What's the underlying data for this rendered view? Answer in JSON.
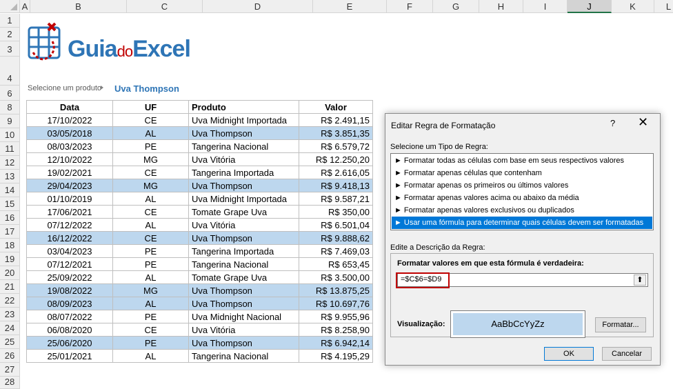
{
  "columns": [
    "A",
    "B",
    "C",
    "D",
    "E",
    "F",
    "G",
    "H",
    "I",
    "J",
    "K",
    "L"
  ],
  "selected_column": "J",
  "rows": [
    "1",
    "2",
    "3",
    "4",
    "6",
    "8",
    "9",
    "10",
    "11",
    "12",
    "13",
    "14",
    "15",
    "16",
    "17",
    "18",
    "19",
    "20",
    "21",
    "22",
    "23",
    "24",
    "25",
    "26",
    "27",
    "28"
  ],
  "logo": {
    "guia": "Guia",
    "do": "do",
    "excel": "Excel"
  },
  "selector": {
    "label": "Selecione um produto",
    "value": "Uva Thompson"
  },
  "table": {
    "headers": [
      "Data",
      "UF",
      "Produto",
      "Valor"
    ],
    "rows": [
      {
        "data": "17/10/2022",
        "uf": "CE",
        "produto": "Uva Midnight Importada",
        "valor": "R$ 2.491,15",
        "hl": false
      },
      {
        "data": "03/05/2018",
        "uf": "AL",
        "produto": "Uva Thompson",
        "valor": "R$ 3.851,35",
        "hl": true
      },
      {
        "data": "08/03/2023",
        "uf": "PE",
        "produto": "Tangerina Nacional",
        "valor": "R$ 6.579,72",
        "hl": false
      },
      {
        "data": "12/10/2022",
        "uf": "MG",
        "produto": "Uva Vitória",
        "valor": "R$ 12.250,20",
        "hl": false
      },
      {
        "data": "19/02/2021",
        "uf": "CE",
        "produto": "Tangerina Importada",
        "valor": "R$ 2.616,05",
        "hl": false
      },
      {
        "data": "29/04/2023",
        "uf": "MG",
        "produto": "Uva Thompson",
        "valor": "R$ 9.418,13",
        "hl": true
      },
      {
        "data": "01/10/2019",
        "uf": "AL",
        "produto": "Uva Midnight Importada",
        "valor": "R$ 9.587,21",
        "hl": false
      },
      {
        "data": "17/06/2021",
        "uf": "CE",
        "produto": "Tomate Grape Uva",
        "valor": "R$ 350,00",
        "hl": false
      },
      {
        "data": "07/12/2022",
        "uf": "AL",
        "produto": "Uva Vitória",
        "valor": "R$ 6.501,04",
        "hl": false
      },
      {
        "data": "16/12/2022",
        "uf": "CE",
        "produto": "Uva Thompson",
        "valor": "R$ 9.888,62",
        "hl": true
      },
      {
        "data": "03/04/2023",
        "uf": "PE",
        "produto": "Tangerina Importada",
        "valor": "R$ 7.469,03",
        "hl": false
      },
      {
        "data": "07/12/2021",
        "uf": "PE",
        "produto": "Tangerina Nacional",
        "valor": "R$ 653,45",
        "hl": false
      },
      {
        "data": "25/09/2022",
        "uf": "AL",
        "produto": "Tomate Grape Uva",
        "valor": "R$ 3.500,00",
        "hl": false
      },
      {
        "data": "19/08/2022",
        "uf": "MG",
        "produto": "Uva Thompson",
        "valor": "R$ 13.875,25",
        "hl": true
      },
      {
        "data": "08/09/2023",
        "uf": "AL",
        "produto": "Uva Thompson",
        "valor": "R$ 10.697,76",
        "hl": true
      },
      {
        "data": "08/07/2022",
        "uf": "PE",
        "produto": "Uva Midnight Nacional",
        "valor": "R$ 9.955,96",
        "hl": false
      },
      {
        "data": "06/08/2020",
        "uf": "CE",
        "produto": "Uva Vitória",
        "valor": "R$ 8.258,90",
        "hl": false
      },
      {
        "data": "25/06/2020",
        "uf": "PE",
        "produto": "Uva Thompson",
        "valor": "R$ 6.942,14",
        "hl": true
      },
      {
        "data": "25/01/2021",
        "uf": "AL",
        "produto": "Tangerina Nacional",
        "valor": "R$ 4.195,29",
        "hl": false
      }
    ]
  },
  "dialog": {
    "title": "Editar Regra de Formatação",
    "help": "?",
    "close": "✕",
    "rule_type_label": "Selecione um Tipo de Regra:",
    "rule_types": [
      "Formatar todas as células com base em seus respectivos valores",
      "Formatar apenas células que contenham",
      "Formatar apenas os primeiros ou últimos valores",
      "Formatar apenas valores acima ou abaixo da média",
      "Formatar apenas valores exclusivos ou duplicados",
      "Usar uma fórmula para determinar quais células devem ser formatadas"
    ],
    "selected_rule_index": 5,
    "description_label": "Edite a Descrição da Regra:",
    "formula_label": "Formatar valores em que esta fórmula é verdadeira:",
    "formula_value": "=$C$6=$D9",
    "preview_label": "Visualização:",
    "preview_text": "AaBbCcYyZz",
    "format_button": "Formatar...",
    "ok_button": "OK",
    "cancel_button": "Cancelar"
  },
  "colors": {
    "highlight": "#bdd7ee",
    "accent": "#2e75b6",
    "selection": "#0078d7",
    "formula_border": "#c00000"
  }
}
